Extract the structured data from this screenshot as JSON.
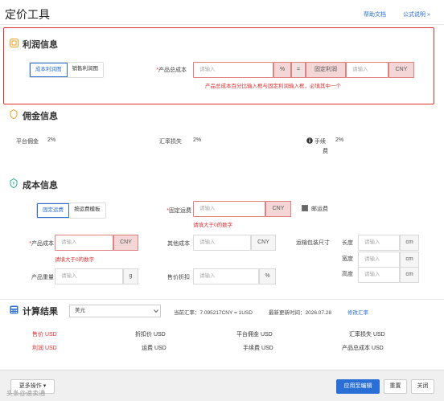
{
  "header": {
    "title": "定价工具",
    "help_link": "帮助文档",
    "formula_link": "公式说明 »"
  },
  "profit": {
    "section_title": "利润信息",
    "tabs": [
      "成本利润图",
      "销售利润图"
    ],
    "total_cost_label": "产品总成本",
    "total_cost_placeholder": "请输入",
    "percent_unit": "%",
    "equals": "=",
    "fixed_profit_label": "固定利润",
    "fixed_profit_placeholder": "请输入",
    "currency": "CNY",
    "error": "产品总成本百分比输入框与固定利润输入框，必填其中一个"
  },
  "commission": {
    "section_title": "佣金信息",
    "platform_label": "平台佣金",
    "platform_value": "2%",
    "fx_loss_label": "汇率损失",
    "fx_loss_value": "2%",
    "fee_label_1": "手续",
    "fee_label_2": "费",
    "fee_value": "2%"
  },
  "cost": {
    "section_title": "成本信息",
    "shipping_tabs": [
      "固定运费",
      "按运费模板"
    ],
    "fixed_shipping_label": "固定运费",
    "fixed_shipping_placeholder": "请输入",
    "fixed_shipping_unit": "CNY",
    "fixed_shipping_error": "请填大于0的数字",
    "include_shipping_label": "邮运费",
    "product_cost_label": "产品成本",
    "product_cost_placeholder": "请输入",
    "product_cost_unit": "CNY",
    "product_cost_error": "请填大于0的数字",
    "other_cost_label": "其他成本",
    "other_cost_placeholder": "请输入",
    "other_cost_unit": "CNY",
    "package_size_label": "运输包装尺寸",
    "length_label": "长度",
    "width_label": "宽度",
    "height_label": "高度",
    "dim_placeholder": "请输入",
    "dim_unit": "cm",
    "weight_label": "产品重量",
    "weight_placeholder": "请输入",
    "weight_unit": "g",
    "discount_label": "售价折扣",
    "discount_placeholder": "请输入",
    "discount_unit": "%"
  },
  "result": {
    "section_title": "计算结果",
    "currency_select": "美元",
    "rate_text": "当前汇率：7.095217CNY = 1USD",
    "updated_text": "最新更新时间：2026.07.28",
    "edit_rate_link": "修改汇率",
    "row1": [
      "售价 USD",
      "折扣价 USD",
      "平台佣金 USD",
      "汇率损失 USD"
    ],
    "row2": [
      "利润 USD",
      "运费 USD",
      "手续费 USD",
      "产品总成本 USD"
    ]
  },
  "footer": {
    "more_ops": "更多操作 ▾",
    "apply": "应用至编辑",
    "reset": "重置",
    "close": "关闭",
    "watermark": "头条@速卖通"
  },
  "colors": {
    "accent": "#2a6fd6",
    "error": "#e03030",
    "section_icon": "#e8a020"
  }
}
